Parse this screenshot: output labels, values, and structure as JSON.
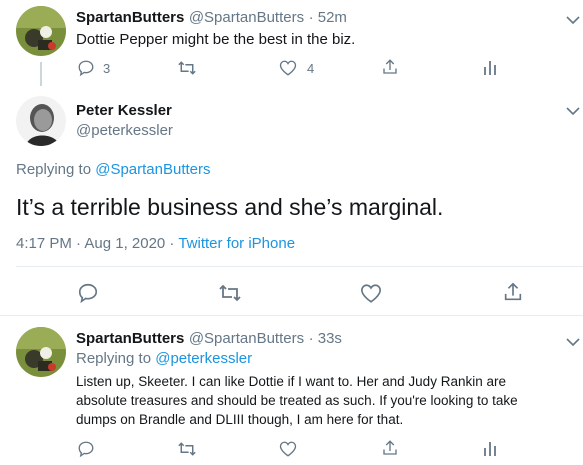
{
  "tweet1": {
    "name": "SpartanButters",
    "handle": "@SpartanButters",
    "time": "· 52m",
    "text": "Dottie Pepper might be the best in the biz.",
    "reply_count": "3",
    "like_count": "4"
  },
  "tweet2": {
    "name": "Peter Kessler",
    "handle": "@peterkessler",
    "replying_prefix": "Replying to ",
    "replying_handle": "@SpartanButters",
    "text": "It’s a terrible business and she’s marginal.",
    "timestamp": "4:17 PM · Aug 1, 2020 · ",
    "source": "Twitter for iPhone"
  },
  "tweet3": {
    "name": "SpartanButters",
    "handle": "@SpartanButters",
    "time": "· 33s",
    "replying_prefix": "Replying to ",
    "replying_handle": "@peterkessler",
    "text_lines": [
      "Listen up, Skeeter.  I can like Dottie if I want to.  Her and Judy Rankin are",
      "absolute treasures and should be treated as such.  If you're looking to take",
      "dumps on Brandle and DLIII though, I am here for that."
    ]
  },
  "icons": {
    "reply": "reply-icon",
    "retweet": "retweet-icon",
    "like": "heart-icon",
    "share": "share-icon",
    "analytics": "analytics-icon",
    "more": "chevron-down-icon"
  },
  "colors": {
    "link": "#1b95e0",
    "muted": "#657786",
    "text": "#14171a",
    "divider": "#e6ecf0"
  }
}
